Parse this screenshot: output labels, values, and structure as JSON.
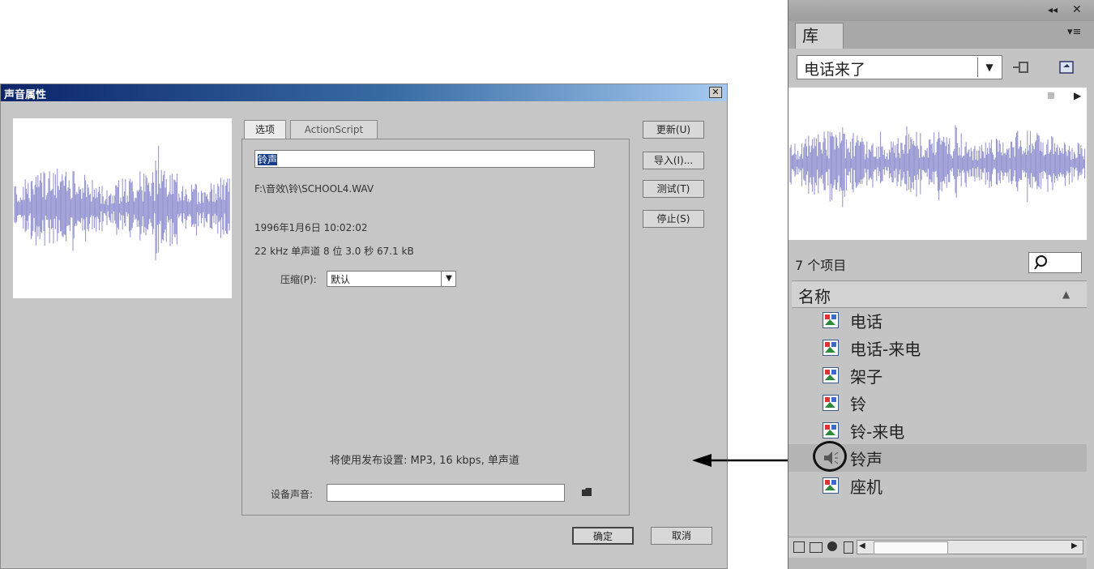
{
  "dialog": {
    "title": "声音属性",
    "close_glyph": "✕",
    "tabs": [
      {
        "label": "选项"
      },
      {
        "label": "ActionScript"
      }
    ],
    "name_value": "铃声",
    "path": "F:\\音效\\铃\\SCHOOL4.WAV",
    "date": "1996年1月6日  10:02:02",
    "format": "22 kHz 单声道 8 位 3.0 秒 67.1 kB",
    "compression_label": "压缩(P):",
    "compression_value": "默认",
    "publish_note": "将使用发布设置: MP3, 16 kbps, 单声道",
    "device_sound_label": "设备声音:",
    "buttons": {
      "update": "更新(U)",
      "import": "导入(I)...",
      "test": "测试(T)",
      "stop": "停止(S)",
      "ok": "确定",
      "cancel": "取消"
    }
  },
  "library": {
    "tab_label": "库",
    "document": "电话来了",
    "item_count": "7 个项目",
    "column_name": "名称",
    "items": [
      {
        "label": "电话",
        "icon": "movieclip-icon"
      },
      {
        "label": "电话-来电",
        "icon": "movieclip-icon"
      },
      {
        "label": "架子",
        "icon": "movieclip-icon"
      },
      {
        "label": "铃",
        "icon": "movieclip-icon"
      },
      {
        "label": "铃-来电",
        "icon": "movieclip-icon"
      },
      {
        "label": "铃声",
        "icon": "sound-icon",
        "selected": true
      },
      {
        "label": "座机",
        "icon": "movieclip-icon"
      }
    ]
  },
  "colors": {
    "waveform": "#8e8ecf",
    "titlebar_start": "#0b246a",
    "titlebar_end": "#a6caf0",
    "selected_row": "#b4b4b4"
  }
}
